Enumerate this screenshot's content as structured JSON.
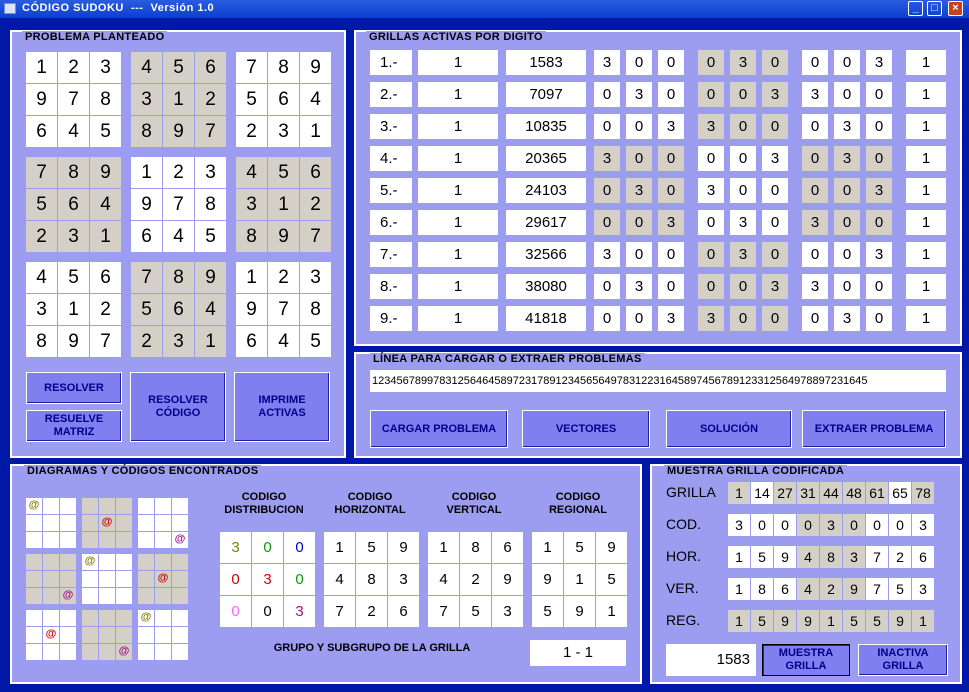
{
  "window": {
    "title": "CÓDIGO SUDOKU  ---  Versión 1.0",
    "min": "_",
    "max": "□",
    "close": "×"
  },
  "problem": {
    "title": "PROBLEMA PLANTEADO",
    "grid": [
      "123456789",
      "978312564",
      "645897231",
      "789123456",
      "564978312",
      "231645897",
      "456789123",
      "312564978",
      "897231645"
    ]
  },
  "buttons": {
    "resolver": "RESOLVER",
    "resuelve_matriz": "RESUELVE MATRIZ",
    "resolver_codigo": "RESOLVER CÓDIGO",
    "imprime_activas": "IMPRIME ACTIVAS",
    "cargar": "CARGAR PROBLEMA",
    "vectores": "VECTORES",
    "solucion": "SOLUCIÓN",
    "extraer": "EXTRAER PROBLEMA",
    "muestra": "MUESTRA GRILLA",
    "inactiva": "INACTIVA GRILLA"
  },
  "active": {
    "title": "GRILLAS ACTIVAS POR DIGITO",
    "rows": [
      {
        "label": "1.-",
        "group": "1",
        "code": "1583",
        "d": [
          "3",
          "0",
          "0",
          "0",
          "3",
          "0",
          "0",
          "0",
          "3"
        ],
        "last": "1"
      },
      {
        "label": "2.-",
        "group": "1",
        "code": "7097",
        "d": [
          "0",
          "3",
          "0",
          "0",
          "0",
          "3",
          "3",
          "0",
          "0"
        ],
        "last": "1"
      },
      {
        "label": "3.-",
        "group": "1",
        "code": "10835",
        "d": [
          "0",
          "0",
          "3",
          "3",
          "0",
          "0",
          "0",
          "3",
          "0"
        ],
        "last": "1"
      },
      {
        "label": "4.-",
        "group": "1",
        "code": "20365",
        "d": [
          "3",
          "0",
          "0",
          "0",
          "0",
          "3",
          "0",
          "3",
          "0"
        ],
        "last": "1"
      },
      {
        "label": "5.-",
        "group": "1",
        "code": "24103",
        "d": [
          "0",
          "3",
          "0",
          "3",
          "0",
          "0",
          "0",
          "0",
          "3"
        ],
        "last": "1"
      },
      {
        "label": "6.-",
        "group": "1",
        "code": "29617",
        "d": [
          "0",
          "0",
          "3",
          "0",
          "3",
          "0",
          "3",
          "0",
          "0"
        ],
        "last": "1"
      },
      {
        "label": "7.-",
        "group": "1",
        "code": "32566",
        "d": [
          "3",
          "0",
          "0",
          "0",
          "3",
          "0",
          "0",
          "0",
          "3"
        ],
        "last": "1"
      },
      {
        "label": "8.-",
        "group": "1",
        "code": "38080",
        "d": [
          "0",
          "3",
          "0",
          "0",
          "0",
          "3",
          "3",
          "0",
          "0"
        ],
        "last": "1"
      },
      {
        "label": "9.-",
        "group": "1",
        "code": "41818",
        "d": [
          "0",
          "0",
          "3",
          "3",
          "0",
          "0",
          "0",
          "3",
          "0"
        ],
        "last": "1"
      }
    ]
  },
  "line": {
    "title": "LÍNEA PARA CARGAR O EXTRAER PROBLEMAS",
    "value": "123456789978312564645897231789123456564978312231645897456789123312564978897231645"
  },
  "diagrams": {
    "title": "DIAGRAMAS Y CÓDIGOS ENCONTRADOS",
    "at": "@",
    "headers": {
      "dist": "CODIGO DISTRIBUCION",
      "hor": "CODIGO HORIZONTAL",
      "ver": "CODIGO VERTICAL",
      "reg": "CODIGO REGIONAL"
    },
    "dist": [
      "3",
      "0",
      "0",
      "0",
      "3",
      "0",
      "0",
      "0",
      "3"
    ],
    "hor": [
      "1",
      "5",
      "9",
      "4",
      "8",
      "3",
      "7",
      "2",
      "6"
    ],
    "ver": [
      "1",
      "8",
      "6",
      "4",
      "2",
      "9",
      "7",
      "5",
      "3"
    ],
    "reg": [
      "1",
      "5",
      "9",
      "9",
      "1",
      "5",
      "5",
      "9",
      "1"
    ],
    "group_label": "GRUPO Y SUBGRUPO DE LA GRILLA",
    "group_value": "1 - 1",
    "colors": {
      "olive": "#808000",
      "green": "#00a000",
      "blue": "#0000e0",
      "red": "#d00000",
      "magenta": "#a0108a",
      "pink": "#ff60ff"
    }
  },
  "encoded": {
    "title": "MUESTRA GRILLA CODIFICADA",
    "labels": {
      "grilla": "GRILLA",
      "cod": "COD.",
      "hor": "HOR.",
      "ver": "VER.",
      "reg": "REG."
    },
    "grilla": [
      "1",
      "14",
      "27",
      "31",
      "44",
      "48",
      "61",
      "65",
      "78"
    ],
    "cod": [
      "3",
      "0",
      "0",
      "0",
      "3",
      "0",
      "0",
      "0",
      "3"
    ],
    "hor": [
      "1",
      "5",
      "9",
      "4",
      "8",
      "3",
      "7",
      "2",
      "6"
    ],
    "ver": [
      "1",
      "8",
      "6",
      "4",
      "2",
      "9",
      "7",
      "5",
      "3"
    ],
    "reg": [
      "1",
      "5",
      "9",
      "9",
      "1",
      "5",
      "5",
      "9",
      "1"
    ],
    "value": "1583"
  }
}
